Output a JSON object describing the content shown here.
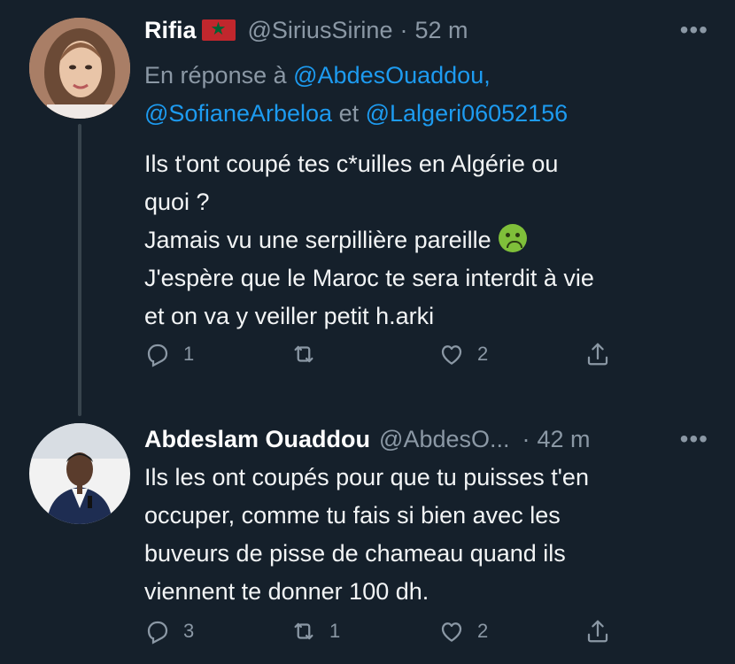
{
  "tweets": [
    {
      "display_name": "Rifia",
      "flag_icon": "morocco-flag-icon",
      "handle": "@SiriusSirine",
      "time": "52 m",
      "reply_prefix": "En réponse à",
      "reply_handles": [
        "@AbdesOuaddou,",
        "@SofianeArbeloa",
        "@Lalgeri06052156"
      ],
      "reply_joiner": "et",
      "lines": [
        "Ils t'ont coupé tes c*uilles en Algérie ou",
        "quoi ?",
        "Jamais vu une serpillière pareille",
        "J'espère que le Maroc te sera interdit à vie",
        "et on va y veiller petit h.arki"
      ],
      "emoji": "nauseated-face-icon",
      "stats": {
        "replies": "1",
        "retweets": "",
        "likes": "2"
      }
    },
    {
      "display_name": "Abdeslam Ouaddou",
      "handle": "@AbdesO...",
      "time": "42 m",
      "lines": [
        "Ils les ont coupés pour que tu puisses t'en",
        "occuper, comme tu fais si bien avec les",
        "buveurs de pisse de chameau quand ils",
        "viennent te donner 100 dh."
      ],
      "stats": {
        "replies": "3",
        "retweets": "1",
        "likes": "2"
      }
    }
  ],
  "more_label": "•••",
  "separator": "·",
  "colors": {
    "background": "#15202b",
    "link": "#1d9bf0",
    "muted": "#8b98a5"
  }
}
